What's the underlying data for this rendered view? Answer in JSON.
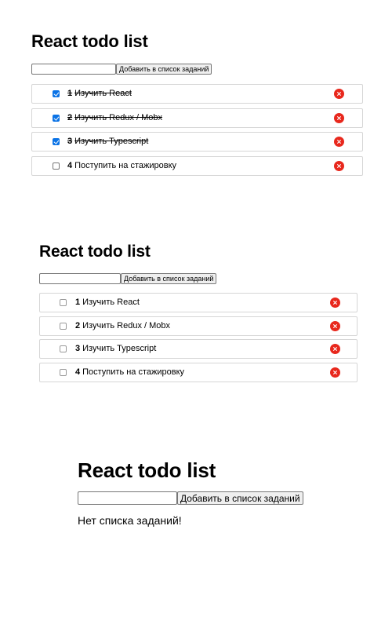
{
  "panels": [
    {
      "title": "React todo list",
      "input": {
        "value": "",
        "placeholder": ""
      },
      "add_button_label": "Добавить в список заданий",
      "todos": [
        {
          "num": "1",
          "text": "Изучить React",
          "completed": true
        },
        {
          "num": "2",
          "text": "Изучить Redux / Mobx",
          "completed": true
        },
        {
          "num": "3",
          "text": "Изучить Typescript",
          "completed": true
        },
        {
          "num": "4",
          "text": "Поступить на стажировку",
          "completed": false
        }
      ]
    },
    {
      "title": "React todo list",
      "input": {
        "value": "",
        "placeholder": ""
      },
      "add_button_label": "Добавить в список заданий",
      "todos": [
        {
          "num": "1",
          "text": "Изучить React",
          "completed": false
        },
        {
          "num": "2",
          "text": "Изучить Redux / Mobx",
          "completed": false
        },
        {
          "num": "3",
          "text": "Изучить Typescript",
          "completed": false
        },
        {
          "num": "4",
          "text": "Поступить на стажировку",
          "completed": false
        }
      ]
    },
    {
      "title": "React todo list",
      "input": {
        "value": "",
        "placeholder": ""
      },
      "add_button_label": "Добавить в список заданий",
      "empty_message": "Нет списка заданий!"
    }
  ],
  "icons": {
    "checkbox_checked": "checkbox-checked-icon",
    "checkbox_unchecked": "checkbox-icon",
    "delete": "delete-x-icon"
  },
  "colors": {
    "checkbox_checked": "#0b73e6",
    "delete_button": "#e8281d",
    "item_border": "#d6d6d6",
    "button_bg": "#efefef"
  }
}
